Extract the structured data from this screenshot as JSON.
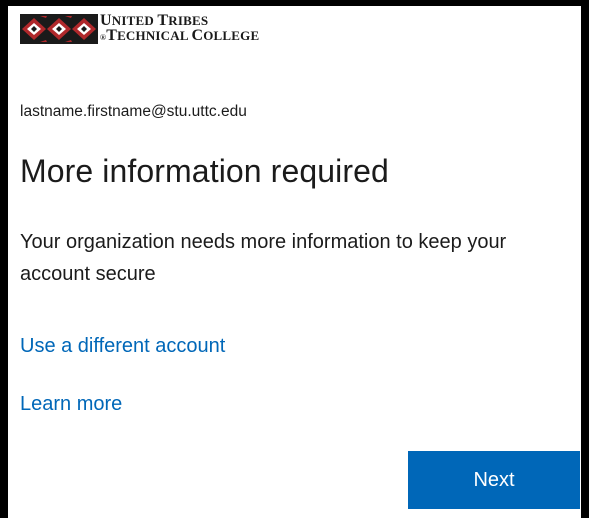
{
  "logo": {
    "line1_cap1": "U",
    "line1_rest1": "NITED ",
    "line1_cap2": "T",
    "line1_rest2": "RIBES",
    "line2_reg": "®",
    "line2_cap1": "T",
    "line2_rest1": "ECHNICAL ",
    "line2_cap2": "C",
    "line2_rest2": "OLLEGE",
    "mark_colors": {
      "red": "#b0282b",
      "dark": "#1a1a1a",
      "white": "#ffffff"
    }
  },
  "account": {
    "email": "lastname.firstname@stu.uttc.edu"
  },
  "heading": {
    "title": "More information required"
  },
  "message": {
    "text": "Your organization needs more information to keep your account secure"
  },
  "links": {
    "use_different_account": "Use a different account",
    "learn_more": "Learn more"
  },
  "actions": {
    "next_label": "Next"
  },
  "colors": {
    "accent": "#0067b8",
    "text": "#1b1b1b",
    "background": "#ffffff"
  }
}
